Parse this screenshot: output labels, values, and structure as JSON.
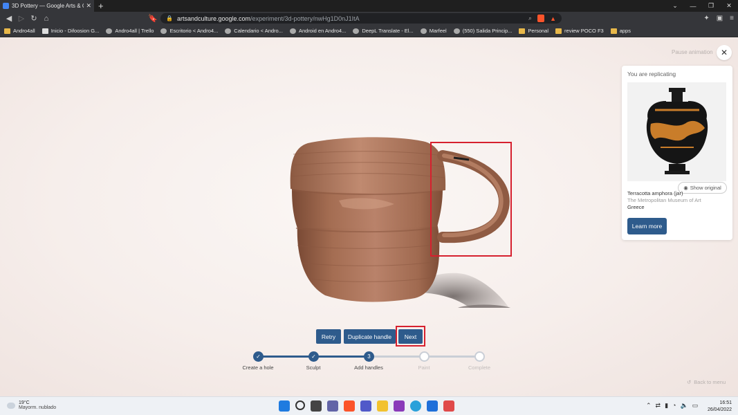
{
  "browser": {
    "tab_title": "3D Pottery — Google Arts & Cult",
    "url_host": "artsandculture.google.com",
    "url_path": "/experiment/3d-pottery/nwHg1D0nJ1ItA",
    "bookmarks": [
      {
        "label": "Andro4all",
        "icon": "folder-icon"
      },
      {
        "label": "Inicio - Difoosion G...",
        "icon": "page-icon"
      },
      {
        "label": "Andro4all | Trello",
        "icon": "trello-icon"
      },
      {
        "label": "Escritorio < Andro4...",
        "icon": "wordpress-icon"
      },
      {
        "label": "Calendario < Andro...",
        "icon": "wordpress-icon"
      },
      {
        "label": "Android en Andro4...",
        "icon": "android-icon"
      },
      {
        "label": "DeepL Translate - El...",
        "icon": "deepl-icon"
      },
      {
        "label": "Marfeel",
        "icon": "marfeel-icon"
      },
      {
        "label": "(550) Salida Princip...",
        "icon": "channel-icon"
      },
      {
        "label": "Personal",
        "icon": "folder-icon"
      },
      {
        "label": "review POCO F3",
        "icon": "folder-icon"
      },
      {
        "label": "apps",
        "icon": "folder-icon"
      }
    ]
  },
  "page": {
    "pause_label": "Pause animation",
    "card": {
      "heading": "You are replicating",
      "show_original": "Show original",
      "object_name": "Terracotta amphora (jar)",
      "museum": "The Metropolitan Museum of Art",
      "place": "Greece",
      "learn_more": "Learn more"
    },
    "actions": {
      "retry": "Retry",
      "duplicate_handle": "Duplicate handle",
      "next": "Next"
    },
    "steps": [
      {
        "label": "Create a hole",
        "state": "done",
        "mark": "✓"
      },
      {
        "label": "Sculpt",
        "state": "done",
        "mark": "✓"
      },
      {
        "label": "Add handles",
        "state": "current",
        "mark": "3"
      },
      {
        "label": "Paint",
        "state": "todo",
        "mark": ""
      },
      {
        "label": "Complete",
        "state": "todo",
        "mark": ""
      }
    ],
    "back_to_menu": "Back to menu"
  },
  "taskbar": {
    "temperature": "19°C",
    "weather": "Mayorm. nublado",
    "time": "16:51",
    "date": "26/04/2022"
  },
  "colors": {
    "accent": "#2e5b8c",
    "highlight": "#d6202e",
    "clay": "#b07a5c"
  }
}
